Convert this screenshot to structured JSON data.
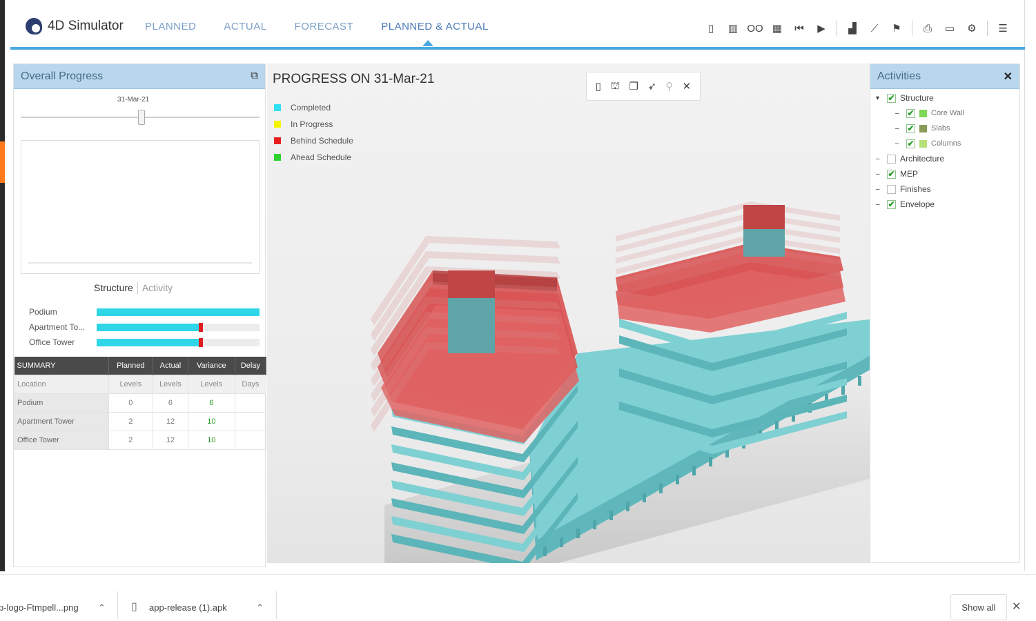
{
  "app": {
    "title": "4D Simulator"
  },
  "nav": {
    "tabs": [
      "PLANNED",
      "ACTUAL",
      "FORECAST",
      "PLANNED & ACTUAL"
    ],
    "active_index": 3
  },
  "toolbar": {
    "icons": [
      "phone-icon",
      "barcode-icon",
      "infinity-icon",
      "calendar-icon",
      "skip-back-icon",
      "play-icon",
      "bar-chart-icon",
      "line-chart-icon",
      "hierarchy-icon",
      "print-icon",
      "monitor-icon",
      "share-icon",
      "menu-icon"
    ],
    "infinity_text": "OO"
  },
  "overall": {
    "title": "Overall Progress",
    "slider_date": "31-Mar-21",
    "slider_position": 0.5,
    "toggle": {
      "on": "Structure",
      "off": "Activity"
    },
    "progress": [
      {
        "label": "Podium",
        "actual": 1.0,
        "planned": null
      },
      {
        "label": "Apartment To...",
        "actual": 0.64,
        "planned": 0.64
      },
      {
        "label": "Office Tower",
        "actual": 0.64,
        "planned": 0.64
      }
    ]
  },
  "summary": {
    "headers": [
      "SUMMARY",
      "Planned",
      "Actual",
      "Variance",
      "Delay"
    ],
    "units": [
      "Location",
      "Levels",
      "Levels",
      "Levels",
      "Days"
    ],
    "rows": [
      [
        "Podium",
        "0",
        "6",
        "6",
        ""
      ],
      [
        "Apartment Tower",
        "2",
        "12",
        "10",
        ""
      ],
      [
        "Office Tower",
        "2",
        "12",
        "10",
        ""
      ]
    ]
  },
  "viewport": {
    "title": "PROGRESS ON  31-Mar-21",
    "legend": [
      {
        "label": "Completed",
        "color": "#2fe0f0"
      },
      {
        "label": "In Progress",
        "color": "#f5f500"
      },
      {
        "label": "Behind Schedule",
        "color": "#e61e1e"
      },
      {
        "label": "Ahead Schedule",
        "color": "#2ed12e"
      }
    ],
    "tools": [
      "phone-icon",
      "binoculars-icon",
      "copy-icon",
      "rocket-icon",
      "pin-icon",
      "fullscreen-icon"
    ]
  },
  "activities": {
    "title": "Activities",
    "tree": [
      {
        "label": "Structure",
        "checked": true,
        "level": 0,
        "color": null
      },
      {
        "label": "Core Wall",
        "checked": true,
        "level": 1,
        "color": "#7ed957"
      },
      {
        "label": "Slabs",
        "checked": true,
        "level": 1,
        "color": "#8a9a5b"
      },
      {
        "label": "Columns",
        "checked": true,
        "level": 1,
        "color": "#b5e07a"
      },
      {
        "label": "Architecture",
        "checked": false,
        "level": 0,
        "color": null
      },
      {
        "label": "MEP",
        "checked": true,
        "level": 0,
        "color": null
      },
      {
        "label": "Finishes",
        "checked": false,
        "level": 0,
        "color": null
      },
      {
        "label": "Envelope",
        "checked": true,
        "level": 0,
        "color": null
      }
    ]
  },
  "downloads": {
    "items": [
      {
        "name": "p-logo-Ftmpell...png"
      },
      {
        "name": "app-release (1).apk"
      }
    ],
    "show_all": "Show all"
  },
  "colors": {
    "accent": "#4aa8e0",
    "completed": "#6ec9cc",
    "behind": "#d94a4a"
  }
}
